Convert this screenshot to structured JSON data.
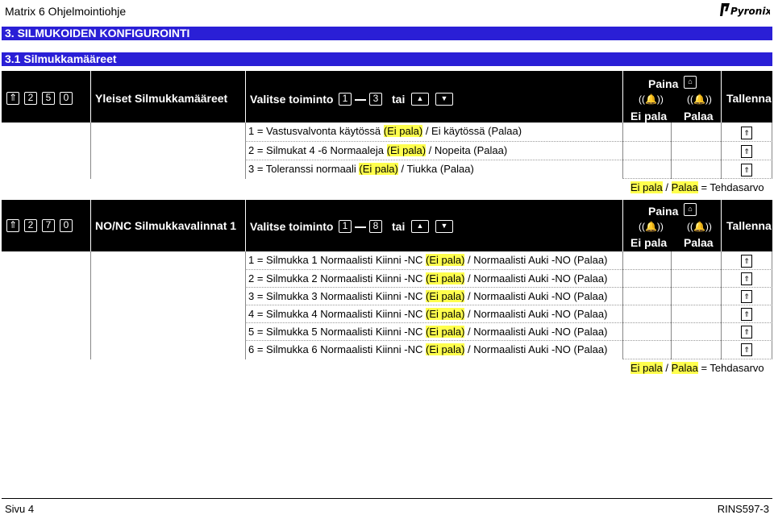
{
  "header": {
    "title": "Matrix 6 Ohjelmointiohje",
    "logo_text": "Pyronix"
  },
  "chapter": "3. SILMUKOIDEN KONFIGUROINTI",
  "section": "3.1 Silmukkamääreet",
  "block1": {
    "keys": [
      "2",
      "5",
      "0"
    ],
    "name": "Yleiset Silmukkamääreet",
    "instruction": "Valitse toiminto",
    "range_from": "1",
    "range_to": "3",
    "tai": "tai",
    "paina": "Paina",
    "ei_pala": "Ei pala",
    "palaa": "Palaa",
    "tallenna": "Tallenna",
    "rows": [
      {
        "pre": "1 = Vastusvalvonta käytössä ",
        "hl": "(Ei pala)",
        "post": " / Ei käytössä (Palaa)"
      },
      {
        "pre": "2 = Silmukat 4 -6 Normaaleja ",
        "hl": "(Ei pala)",
        "post": " / Nopeita (Palaa)"
      },
      {
        "pre": "3 = Toleranssi normaali ",
        "hl": "(Ei pala)",
        "post": " / Tiukka (Palaa)"
      }
    ],
    "default": {
      "a": "Ei pala",
      "sep": " / ",
      "b": "Palaa",
      "rest": " = Tehdasarvo"
    }
  },
  "block2": {
    "keys": [
      "2",
      "7",
      "0"
    ],
    "name": "NO/NC Silmukkavalinnat 1",
    "instruction": "Valitse toiminto",
    "range_from": "1",
    "range_to": "8",
    "tai": "tai",
    "paina": "Paina",
    "ei_pala": "Ei pala",
    "palaa": "Palaa",
    "tallenna": "Tallenna",
    "rows": [
      {
        "pre": "1 = Silmukka 1 Normaalisti Kiinni -NC ",
        "hl": "(Ei pala)",
        "post": " / Normaalisti Auki -NO (Palaa)"
      },
      {
        "pre": "2 = Silmukka 2 Normaalisti Kiinni -NC ",
        "hl": "(Ei pala)",
        "post": " / Normaalisti Auki -NO (Palaa)"
      },
      {
        "pre": "3 = Silmukka 3 Normaalisti Kiinni -NC ",
        "hl": "(Ei pala)",
        "post": " / Normaalisti Auki -NO (Palaa)"
      },
      {
        "pre": "4 = Silmukka 4 Normaalisti Kiinni -NC ",
        "hl": "(Ei pala)",
        "post": " / Normaalisti Auki -NO (Palaa)"
      },
      {
        "pre": "5 = Silmukka 5 Normaalisti Kiinni -NC ",
        "hl": "(Ei pala)",
        "post": " / Normaalisti Auki -NO (Palaa)"
      },
      {
        "pre": "6 = Silmukka 6 Normaalisti Kiinni -NC ",
        "hl": "(Ei pala)",
        "post": " / Normaalisti Auki -NO (Palaa)"
      }
    ],
    "default": {
      "a": "Ei pala",
      "sep": " / ",
      "b": "Palaa",
      "rest": " = Tehdasarvo"
    }
  },
  "footer": {
    "left": "Sivu 4",
    "right": "RINS597-3"
  },
  "colors": {
    "blue_bar": "#2a1fd6",
    "highlight": "#ffff4d"
  }
}
